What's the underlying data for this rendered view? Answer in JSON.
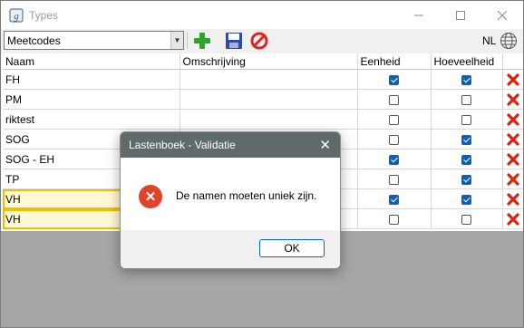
{
  "window": {
    "title": "Types"
  },
  "toolbar": {
    "combo_value": "Meetcodes",
    "language": "NL"
  },
  "grid": {
    "columns": [
      "Naam",
      "Omschrijving",
      "Eenheid",
      "Hoeveelheid",
      ""
    ],
    "rows": [
      {
        "naam": "FH",
        "omschrijving": "",
        "eenheid": true,
        "hoeveelheid": true
      },
      {
        "naam": "PM",
        "omschrijving": "",
        "eenheid": false,
        "hoeveelheid": false
      },
      {
        "naam": "riktest",
        "omschrijving": "",
        "eenheid": false,
        "hoeveelheid": false
      },
      {
        "naam": "SOG",
        "omschrijving": "",
        "eenheid": false,
        "hoeveelheid": true
      },
      {
        "naam": "SOG - EH",
        "omschrijving": "",
        "eenheid": true,
        "hoeveelheid": true
      },
      {
        "naam": "TP",
        "omschrijving": "",
        "eenheid": false,
        "hoeveelheid": true
      },
      {
        "naam": "VH",
        "omschrijving": "",
        "eenheid": true,
        "hoeveelheid": true
      },
      {
        "naam": "VH",
        "omschrijving": "",
        "eenheid": false,
        "hoeveelheid": false
      }
    ]
  },
  "dialog": {
    "title": "Lastenboek - Validatie",
    "message": "De namen moeten uniek zijn.",
    "ok_label": "OK"
  },
  "colors": {
    "dialog_title_bg": "#5f6b6b",
    "error_red": "#e0422a",
    "duplicate_highlight": "#f0c000",
    "check_blue": "#0a5fbf"
  }
}
